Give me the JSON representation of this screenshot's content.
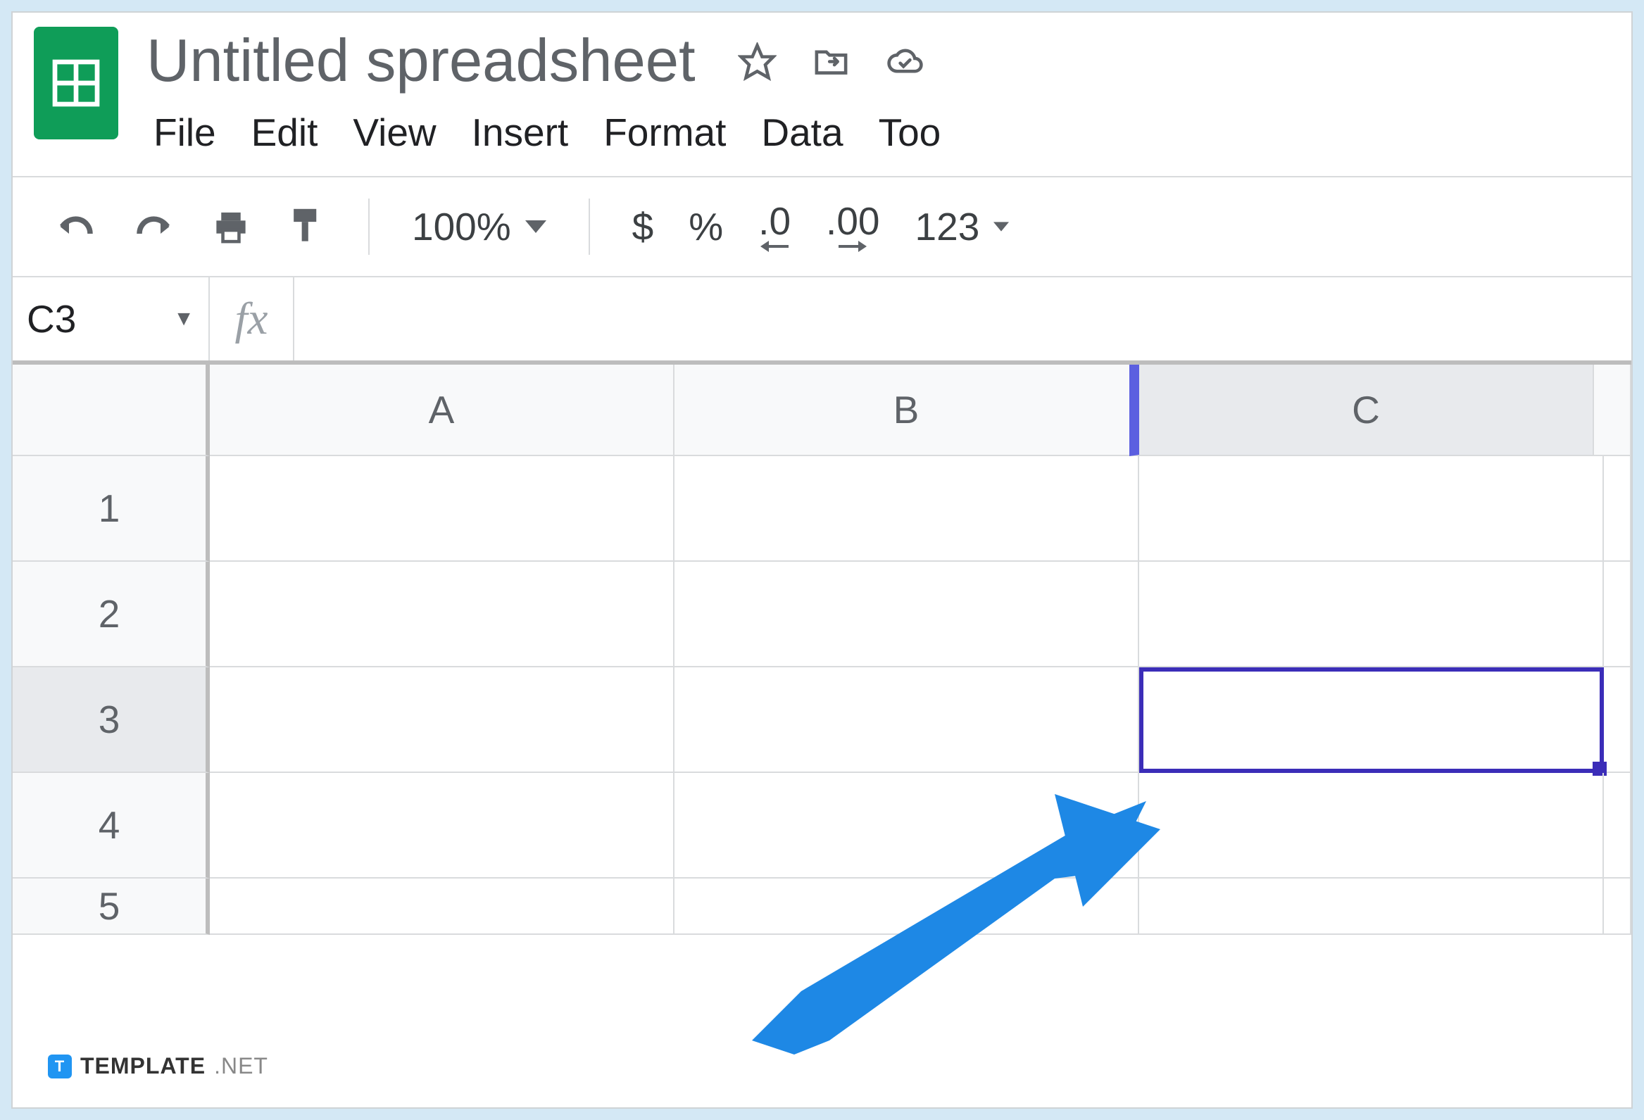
{
  "header": {
    "title": "Untitled spreadsheet",
    "menus": [
      "File",
      "Edit",
      "View",
      "Insert",
      "Format",
      "Data",
      "Too"
    ]
  },
  "toolbar": {
    "zoom": "100%",
    "currency": "$",
    "percent": "%",
    "dec_less": ".0",
    "dec_more": ".00",
    "num_fmt": "123"
  },
  "namebox": {
    "ref": "C3",
    "fx_label": "fx"
  },
  "grid": {
    "columns": [
      "A",
      "B",
      "C"
    ],
    "rows": [
      "1",
      "2",
      "3",
      "4",
      "5"
    ],
    "active_row": "3",
    "active_col": "C",
    "selected_cell": "C3"
  },
  "watermark": {
    "brand": "TEMPLATE",
    "suffix": ".NET"
  }
}
